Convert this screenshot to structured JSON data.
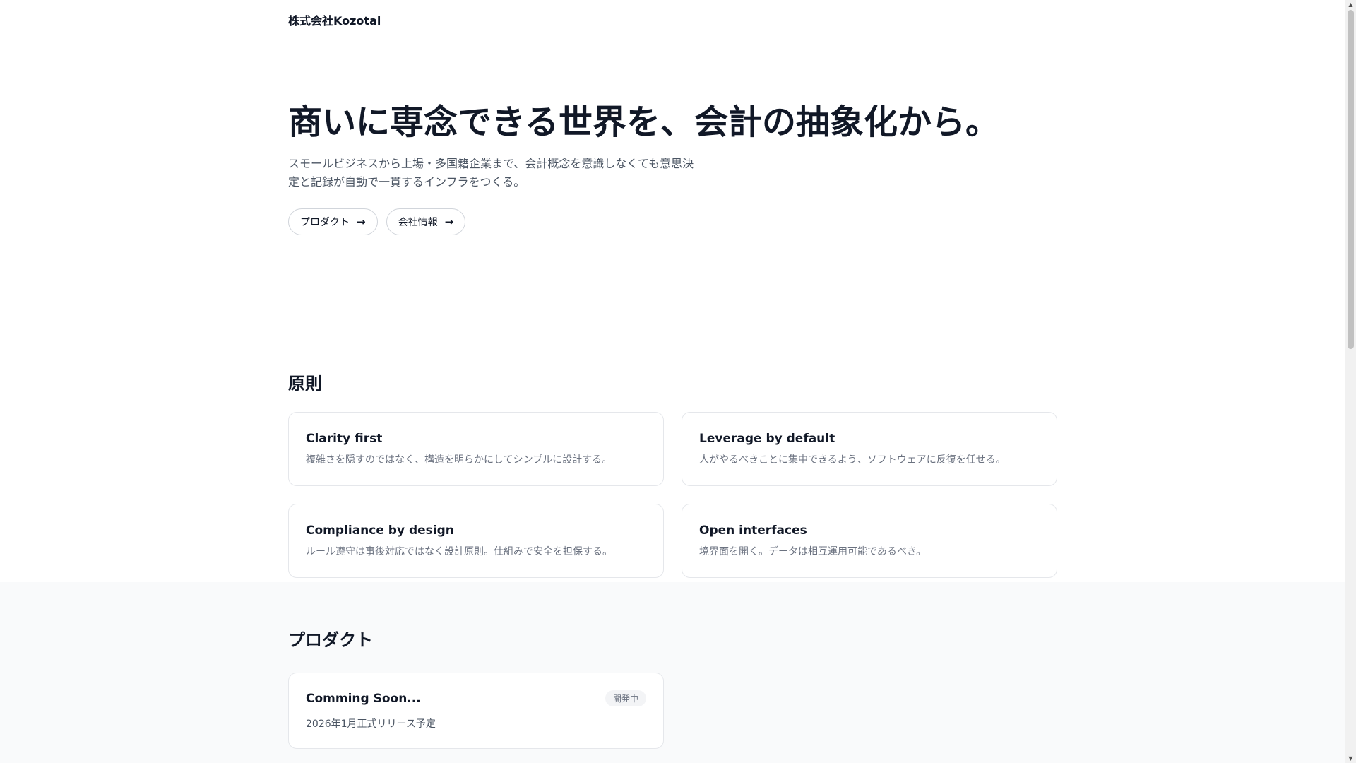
{
  "header": {
    "logo": "株式会社Kozotai"
  },
  "hero": {
    "title": "商いに専念できる世界を、会計の抽象化から。",
    "subtitle": "スモールビジネスから上場・多国籍企業まで、会計概念を意識しなくても意思決定と記録が自動で一貫するインフラをつくる。",
    "buttons": [
      {
        "label": "プロダクト",
        "icon": "arrow-right-icon"
      },
      {
        "label": "会社情報",
        "icon": "arrow-right-icon"
      }
    ]
  },
  "principles": {
    "heading": "原則",
    "items": [
      {
        "title": "Clarity first",
        "desc": "複雑さを隠すのではなく、構造を明らかにしてシンプルに設計する。"
      },
      {
        "title": "Leverage by default",
        "desc": "人がやるべきことに集中できるよう、ソフトウェアに反復を任せる。"
      },
      {
        "title": "Compliance by design",
        "desc": "ルール遵守は事後対応ではなく設計原則。仕組みで安全を担保する。"
      },
      {
        "title": "Open interfaces",
        "desc": "境界面を開く。データは相互運用可能であるべき。"
      }
    ]
  },
  "products": {
    "heading": "プロダクト",
    "items": [
      {
        "title": "Comming Soon...",
        "badge": "開発中",
        "desc": "2026年1月正式リリース予定"
      }
    ]
  }
}
